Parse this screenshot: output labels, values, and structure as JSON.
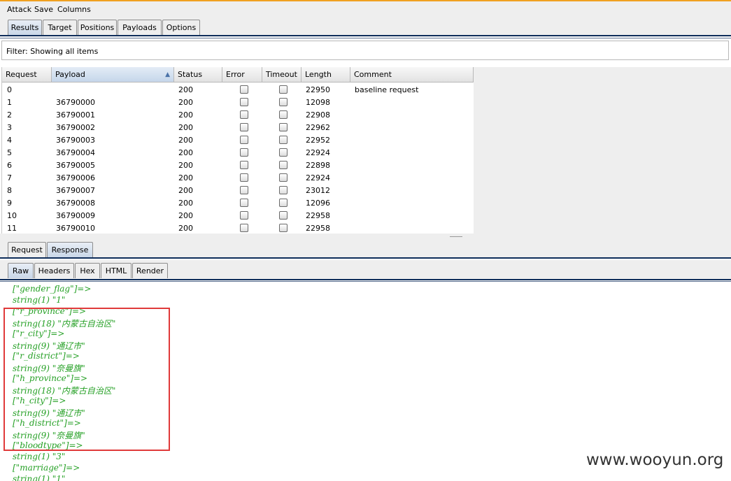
{
  "menu": {
    "attack": "Attack",
    "save": "Save",
    "columns": "Columns"
  },
  "main_tabs": [
    "Results",
    "Target",
    "Positions",
    "Payloads",
    "Options"
  ],
  "filter": {
    "text": "Filter: Showing all items"
  },
  "table": {
    "columns": [
      "Request",
      "Payload",
      "Status",
      "Error",
      "Timeout",
      "Length",
      "Comment"
    ],
    "sorted_column": "Payload",
    "rows": [
      {
        "request": "0",
        "payload": "",
        "status": "200",
        "error": false,
        "timeout": false,
        "length": "22950",
        "comment": "baseline request"
      },
      {
        "request": "1",
        "payload": "36790000",
        "status": "200",
        "error": false,
        "timeout": false,
        "length": "12098",
        "comment": ""
      },
      {
        "request": "2",
        "payload": "36790001",
        "status": "200",
        "error": false,
        "timeout": false,
        "length": "22908",
        "comment": ""
      },
      {
        "request": "3",
        "payload": "36790002",
        "status": "200",
        "error": false,
        "timeout": false,
        "length": "22962",
        "comment": ""
      },
      {
        "request": "4",
        "payload": "36790003",
        "status": "200",
        "error": false,
        "timeout": false,
        "length": "22952",
        "comment": ""
      },
      {
        "request": "5",
        "payload": "36790004",
        "status": "200",
        "error": false,
        "timeout": false,
        "length": "22924",
        "comment": ""
      },
      {
        "request": "6",
        "payload": "36790005",
        "status": "200",
        "error": false,
        "timeout": false,
        "length": "22898",
        "comment": ""
      },
      {
        "request": "7",
        "payload": "36790006",
        "status": "200",
        "error": false,
        "timeout": false,
        "length": "22924",
        "comment": ""
      },
      {
        "request": "8",
        "payload": "36790007",
        "status": "200",
        "error": false,
        "timeout": false,
        "length": "23012",
        "comment": ""
      },
      {
        "request": "9",
        "payload": "36790008",
        "status": "200",
        "error": false,
        "timeout": false,
        "length": "12096",
        "comment": ""
      },
      {
        "request": "10",
        "payload": "36790009",
        "status": "200",
        "error": false,
        "timeout": false,
        "length": "22958",
        "comment": ""
      },
      {
        "request": "11",
        "payload": "36790010",
        "status": "200",
        "error": false,
        "timeout": false,
        "length": "22958",
        "comment": ""
      }
    ]
  },
  "req_resp_tabs": [
    "Request",
    "Response"
  ],
  "view_tabs": [
    "Raw",
    "Headers",
    "Hex",
    "HTML",
    "Render"
  ],
  "response_lines": [
    "[\"gender_flag\"]=>",
    "string(1) \"1\"",
    "[\"r_province\"]=>",
    "string(18) \"内蒙古自治区\"",
    "[\"r_city\"]=>",
    "string(9) \"通辽市\"",
    "[\"r_district\"]=>",
    "string(9) \"奈曼旗\"",
    "[\"h_province\"]=>",
    "string(18) \"内蒙古自治区\"",
    "[\"h_city\"]=>",
    "string(9) \"通辽市\"",
    "[\"h_district\"]=>",
    "string(9) \"奈曼旗\"",
    "[\"bloodtype\"]=>",
    "string(1) \"3\"",
    "[\"marriage\"]=>",
    "string(1) \"1\""
  ],
  "watermark": "www.wooyun.org"
}
